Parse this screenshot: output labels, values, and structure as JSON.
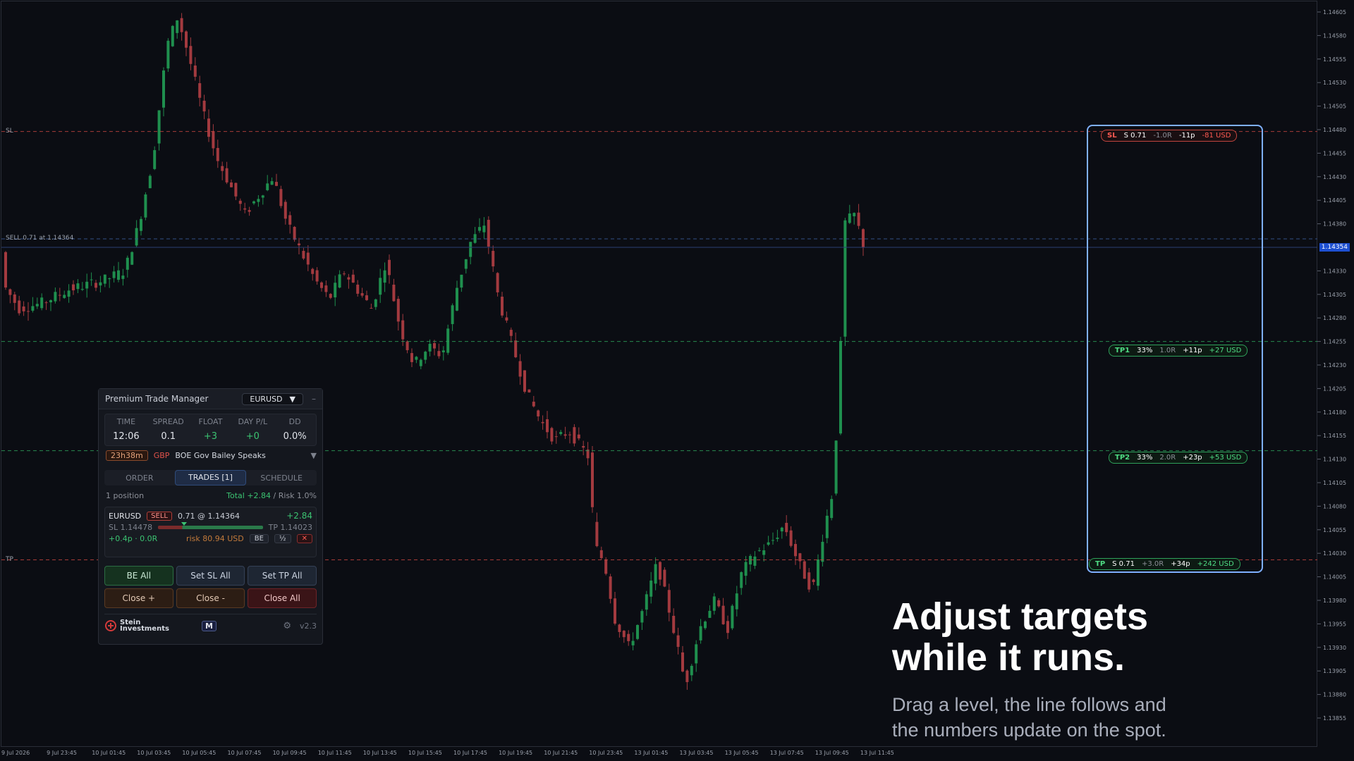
{
  "colors": {
    "background": "#0b0d13",
    "bull": "#1f8f4e",
    "bear": "#a33a3f",
    "sl": "#c2453f",
    "tp": "#2ea05a",
    "accent": "#7fb0ff"
  },
  "chart": {
    "price_ticks": [
      "1.14605",
      "1.14580",
      "1.14555",
      "1.14530",
      "1.14505",
      "1.14480",
      "1.14455",
      "1.14430",
      "1.14405",
      "1.14380",
      "1.14330",
      "1.14305",
      "1.14280",
      "1.14255",
      "1.14230",
      "1.14205",
      "1.14180",
      "1.14155",
      "1.14130",
      "1.14105",
      "1.14080",
      "1.14055",
      "1.14030",
      "1.14005",
      "1.13980",
      "1.13955",
      "1.13930",
      "1.13905",
      "1.13880",
      "1.13855"
    ],
    "current_price": "1.14354",
    "time_ticks": [
      "9 Jul 2026",
      "9 Jul 23:45",
      "10 Jul 01:45",
      "10 Jul 03:45",
      "10 Jul 05:45",
      "10 Jul 07:45",
      "10 Jul 09:45",
      "10 Jul 11:45",
      "10 Jul 13:45",
      "10 Jul 15:45",
      "10 Jul 17:45",
      "10 Jul 19:45",
      "10 Jul 21:45",
      "10 Jul 23:45",
      "13 Jul 01:45",
      "13 Jul 03:45",
      "13 Jul 05:45",
      "13 Jul 07:45",
      "13 Jul 09:45",
      "13 Jul 11:45"
    ],
    "line_labels": {
      "sl": "SL",
      "sell": "SELL 0.71 at 1.14364",
      "tp": "TP"
    },
    "levels": {
      "sl": 1.14478,
      "entry": 1.14364,
      "tp1": 1.14255,
      "tp2": 1.14139,
      "tp": 1.14023
    }
  },
  "pills": {
    "sl": {
      "tag": "SL",
      "size": "S 0.71",
      "r": "-1.0R",
      "pips": "-11p",
      "usd": "-81 USD"
    },
    "tp1": {
      "tag": "TP1",
      "size": "33%",
      "r": "1.0R",
      "pips": "+11p",
      "usd": "+27 USD"
    },
    "tp2": {
      "tag": "TP2",
      "size": "33%",
      "r": "2.0R",
      "pips": "+23p",
      "usd": "+53 USD"
    },
    "tp": {
      "tag": "TP",
      "size": "S 0.71",
      "r": "+3.0R",
      "pips": "+34p",
      "usd": "+242 USD"
    }
  },
  "panel": {
    "title": "Premium Trade Manager",
    "symbol": "EURUSD",
    "symbol_arrow": "▼",
    "minimize": "–",
    "stats_headers": [
      "TIME",
      "SPREAD",
      "FLOAT",
      "DAY P/L",
      "DD"
    ],
    "stats_values": [
      "12:06",
      "0.1",
      "+3",
      "+0",
      "0.0%"
    ],
    "news": {
      "countdown": "23h38m",
      "currency": "GBP",
      "event": "BOE Gov Bailey Speaks",
      "arrow": "▼"
    },
    "tabs": [
      "ORDER",
      "TRADES [1]",
      "SCHEDULE"
    ],
    "positions": "1 position",
    "total_prefix": "Total",
    "total_value": "+2.84",
    "risk_text": "/ Risk 1.0%",
    "trade": {
      "symbol": "EURUSD",
      "side": "SELL",
      "size_price": "0.71 @ 1.14364",
      "pnl": "+2.84",
      "sl": "SL 1.14478",
      "tp": "TP 1.14023",
      "progress": 0.23,
      "pips_r": "+0.4p · 0.0R",
      "risk": "risk 80.94 USD",
      "be": "BE",
      "half": "½",
      "close": "✕"
    },
    "buttons": [
      "BE All",
      "Set SL All",
      "Set TP All",
      "Close +",
      "Close -",
      "Close All"
    ],
    "brand_line1": "Stein",
    "brand_line2": "Investments",
    "mode": "M",
    "version": "v2.3"
  },
  "headline": [
    "Adjust targets",
    "while it runs."
  ],
  "subtext": [
    "Drag a level, the line follows and",
    "the numbers update on the spot."
  ]
}
